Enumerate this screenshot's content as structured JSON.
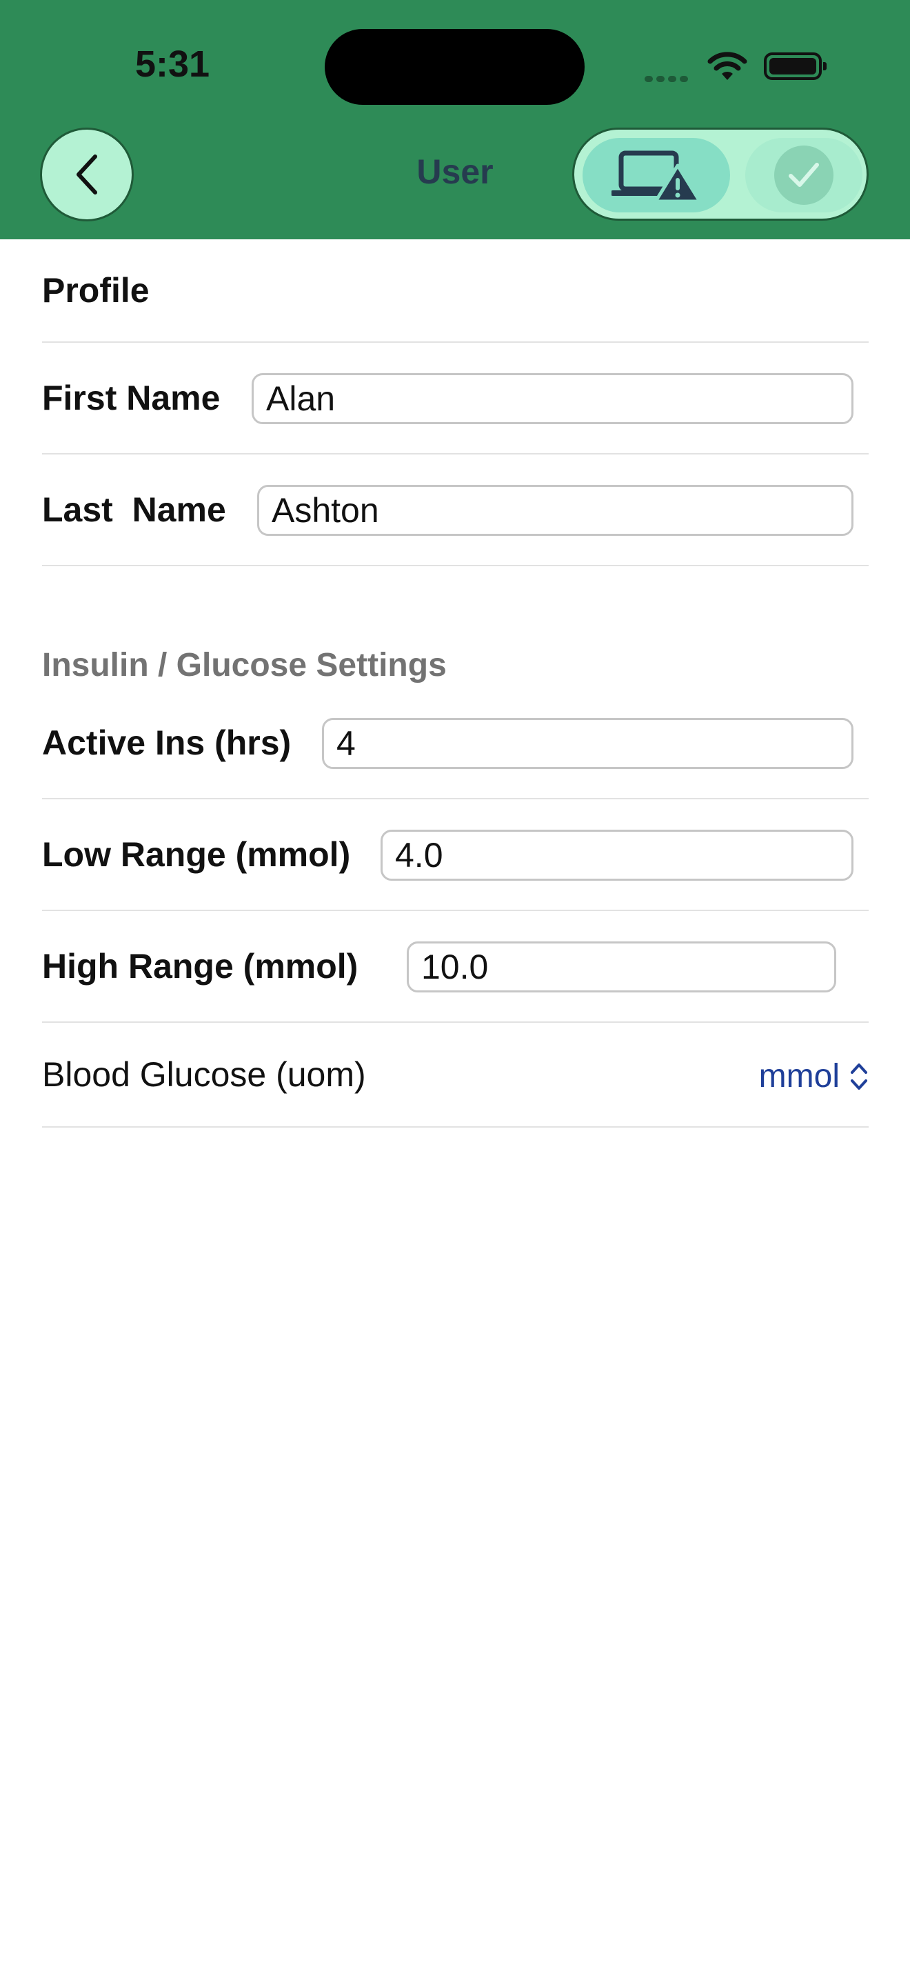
{
  "status_bar": {
    "time": "5:31"
  },
  "header": {
    "title": "User",
    "background_color": "#2e8b57",
    "back_icon": "chevron-left-icon",
    "device_warning_icon": "laptop-warning-icon",
    "confirm_icon": "checkmark-icon"
  },
  "profile": {
    "section_title": "Profile",
    "first_name_label": "First Name",
    "first_name_value": "Alan",
    "last_name_label": "Last  Name",
    "last_name_value": "Ashton"
  },
  "settings": {
    "section_title": "Insulin / Glucose Settings",
    "active_ins_label": "Active Ins (hrs)",
    "active_ins_value": "4",
    "low_range_label": "Low Range (mmol)",
    "low_range_value": "4.0",
    "high_range_label": "High Range (mmol)",
    "high_range_value": "10.0",
    "uom_label": "Blood Glucose (uom)",
    "uom_value": "mmol",
    "accent_color": "#1f3f99"
  }
}
